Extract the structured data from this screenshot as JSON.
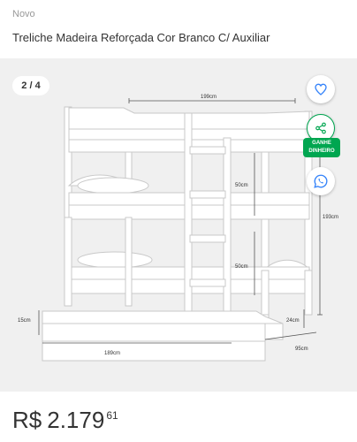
{
  "product": {
    "condition": "Novo",
    "title": "Treliche  Madeira Reforçada Cor Branco C/ Auxiliar"
  },
  "gallery": {
    "counter": "2 / 4",
    "share_label_line1": "GANHE",
    "share_label_line2": "DINHEIRO",
    "dimensions": {
      "top_width": "199cm",
      "mid_gap_top": "50cm",
      "mid_gap_bottom": "50cm",
      "total_height": "193cm",
      "trundle_height": "15cm",
      "trundle_length": "189cm",
      "trundle_offset": "24cm",
      "depth": "95cm"
    },
    "icons": [
      "heart-icon",
      "share-icon",
      "whatsapp-icon"
    ]
  },
  "price": {
    "currency": "R$",
    "integer": "2.179",
    "cents": "61"
  },
  "colors": {
    "accent_blue": "#3483fa",
    "share_green": "#00a650",
    "whatsapp_blue": "#3483fa"
  }
}
